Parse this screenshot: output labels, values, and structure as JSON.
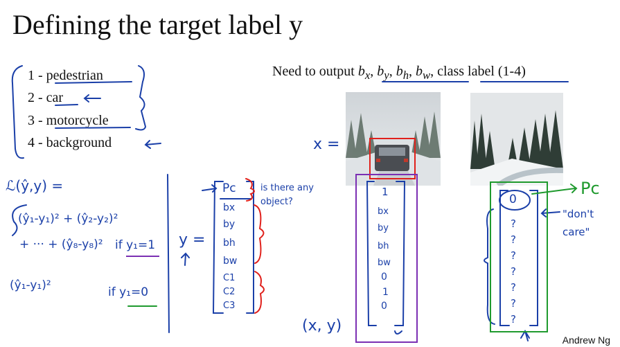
{
  "title": "Defining the target label y",
  "classes": [
    {
      "num": "1 -",
      "name": "pedestrian"
    },
    {
      "num": "2 -",
      "name": "car"
    },
    {
      "num": "3 -",
      "name": "motorcycle"
    },
    {
      "num": "4 -",
      "name": "background"
    }
  ],
  "need_output": {
    "prefix": "Need to output ",
    "bx": "b",
    "bx_sub": "x",
    "by": "b",
    "by_sub": "y",
    "bh": "b",
    "bh_sub": "h",
    "bw": "b",
    "bw_sub": "w",
    "sep": ", ",
    "suffix": "class label (1-4)"
  },
  "handwriting": {
    "x_eq": "x =",
    "loss_lhs": "ℒ(ŷ,y) =",
    "loss_sum": "(ŷ₁-y₁)² + (ŷ₂-y₂)²",
    "loss_sum2": "+ ··· + (ŷ₈-y₈)²",
    "if_y1_1": "if  y₁=1",
    "loss_single": "(ŷ₁-y₁)²",
    "if_y1_0": "if  y₁=0",
    "y_eq": "y =",
    "y_vector": [
      "Pc",
      "bx",
      "by",
      "bh",
      "bw",
      "C1",
      "C2",
      "C3"
    ],
    "pc_note": "is there any object?",
    "car_vector": [
      "1",
      "bx",
      "by",
      "bh",
      "bw",
      "0",
      "1",
      "0"
    ],
    "xy": "(x, y)",
    "bg_vector": [
      "0",
      "?",
      "?",
      "?",
      "?",
      "?",
      "?",
      "?"
    ],
    "pc_label": "Pc",
    "dont_care": "\"don't care\""
  },
  "credit": "Andrew Ng",
  "colors": {
    "ink": "#1a3fa8",
    "red": "#e0201b",
    "green": "#1f9a2e",
    "purple": "#7b2fb3"
  }
}
